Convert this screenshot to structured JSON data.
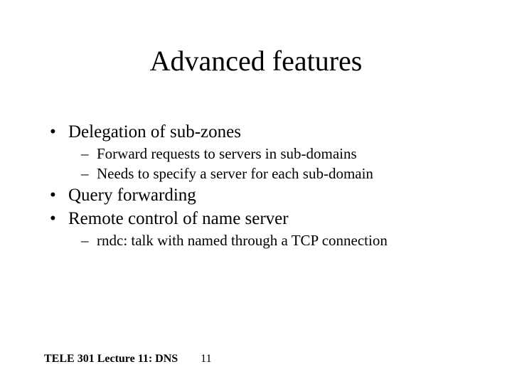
{
  "title": "Advanced features",
  "bullets": [
    {
      "text": "Delegation of sub-zones",
      "sub": [
        "Forward requests to servers in sub-domains",
        "Needs to specify a server for each sub-domain"
      ]
    },
    {
      "text": "Query forwarding",
      "sub": []
    },
    {
      "text": "Remote control of name server",
      "sub": [
        "rndc: talk with named through a TCP connection"
      ]
    }
  ],
  "footer": {
    "course": "TELE 301 Lecture 11: DNS",
    "page": "11"
  }
}
